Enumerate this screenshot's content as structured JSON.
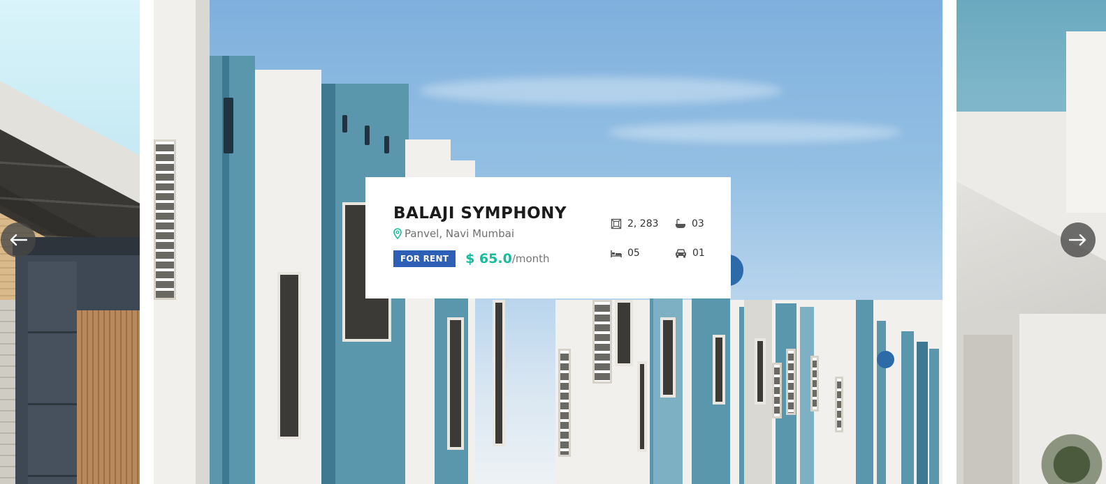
{
  "slider": {
    "prev_label": "Previous",
    "next_label": "Next"
  },
  "property": {
    "title": "BALAJI SYMPHONY",
    "location": "Panvel, Navi Mumbai",
    "status_badge": "FOR RENT",
    "price": "$ 65.0",
    "price_period": "/month",
    "features": {
      "area": "2, 283",
      "bathrooms": "03",
      "bedrooms": "05",
      "garage": "01"
    }
  },
  "colors": {
    "accent_price": "#17bc9c",
    "badge": "#2c5fb5",
    "location_icon": "#17bc9c",
    "arrow_bg": "#464646"
  },
  "icons": {
    "location": "map-pin-icon",
    "area": "area-icon",
    "bathrooms": "bathtub-icon",
    "bedrooms": "bed-icon",
    "garage": "car-icon",
    "prev": "arrow-left-icon",
    "next": "arrow-right-icon"
  }
}
